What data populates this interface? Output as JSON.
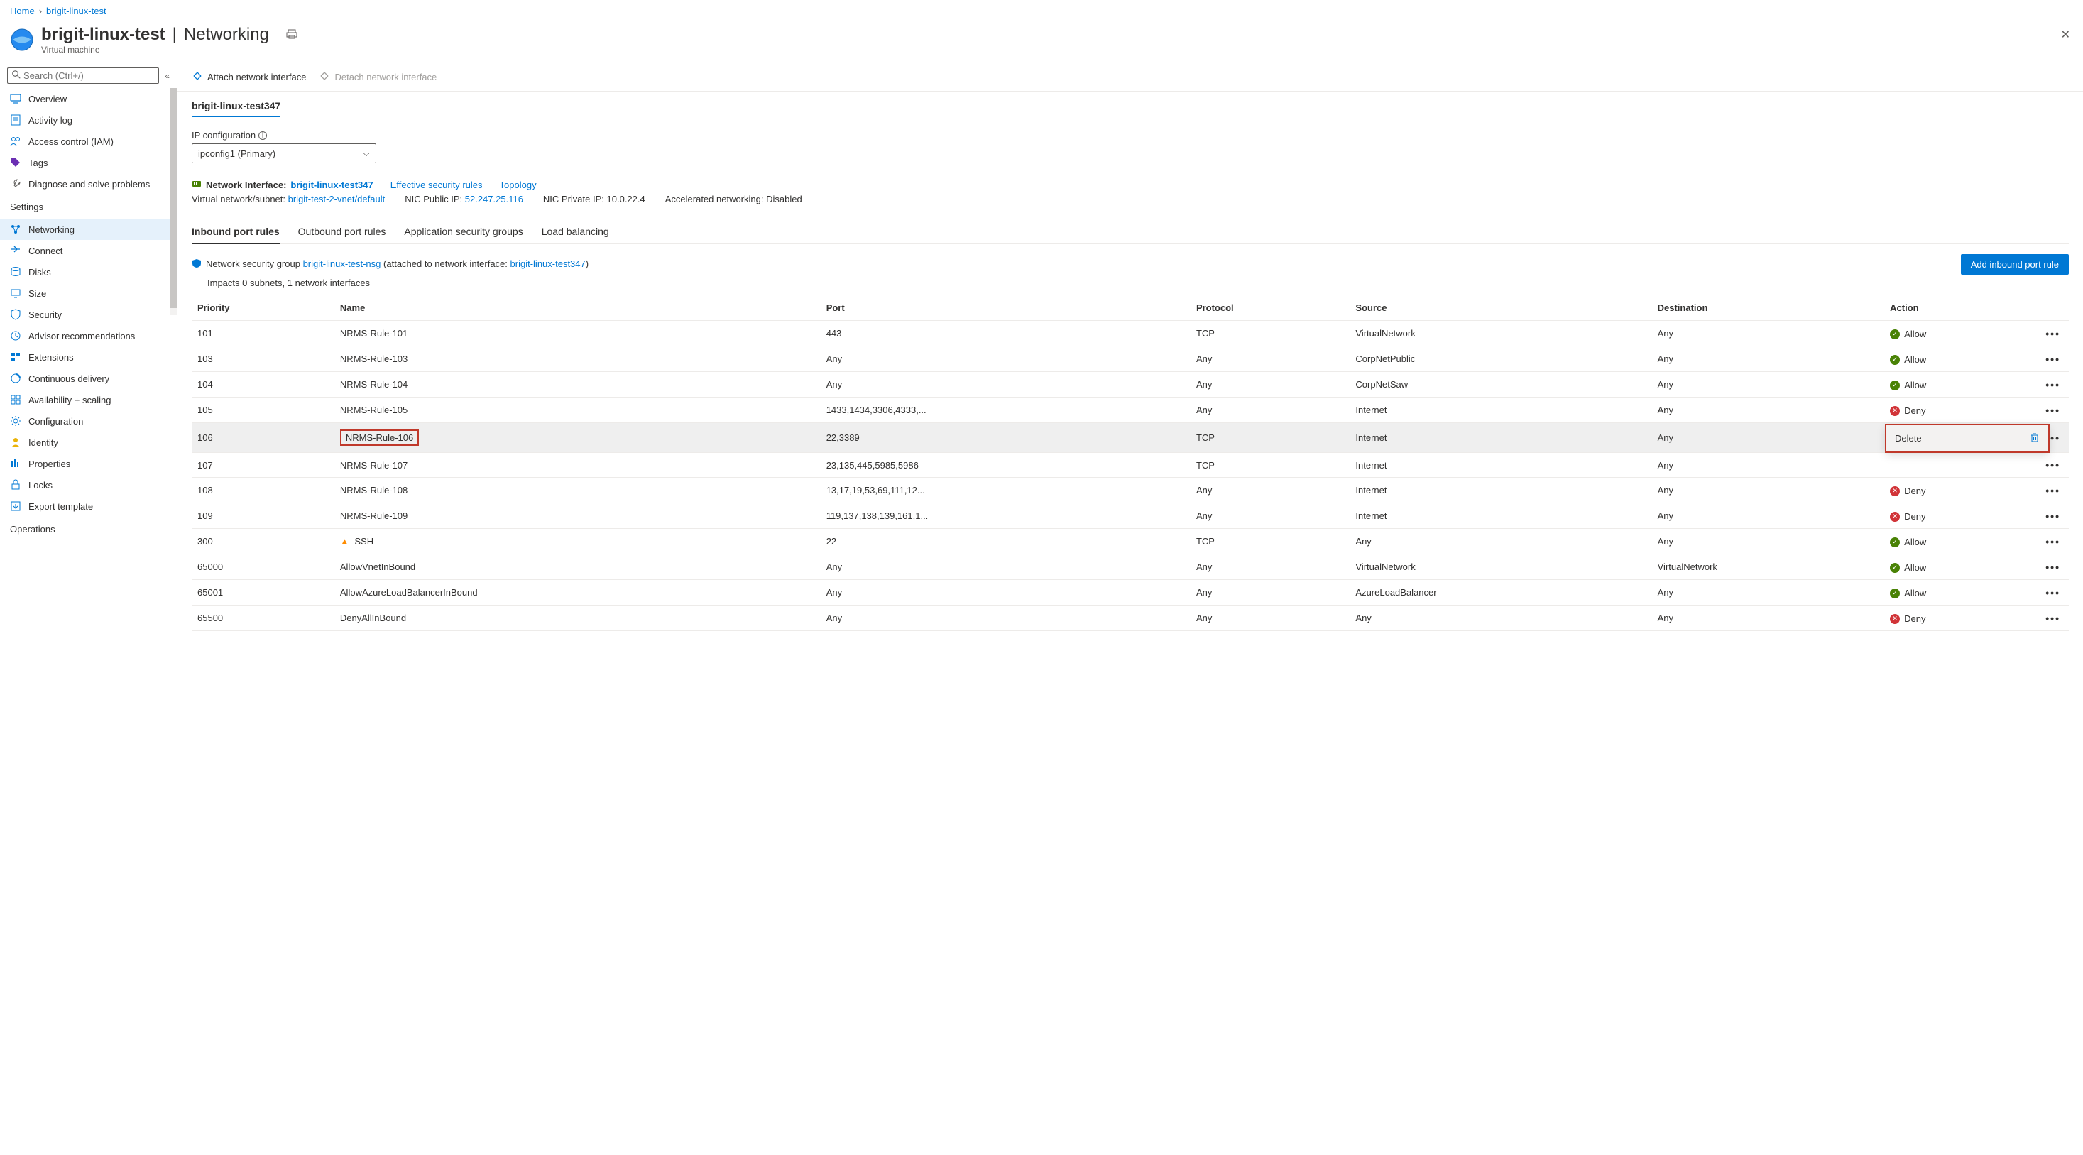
{
  "breadcrumb": {
    "home": "Home",
    "current": "brigit-linux-test"
  },
  "header": {
    "title_main": "brigit-linux-test",
    "title_sub": "Networking",
    "subtitle": "Virtual machine"
  },
  "search": {
    "placeholder": "Search (Ctrl+/)"
  },
  "sidebar": {
    "top_items": [
      {
        "label": "Overview",
        "icon": "monitor"
      },
      {
        "label": "Activity log",
        "icon": "log"
      },
      {
        "label": "Access control (IAM)",
        "icon": "iam"
      },
      {
        "label": "Tags",
        "icon": "tag"
      },
      {
        "label": "Diagnose and solve problems",
        "icon": "wrench"
      }
    ],
    "settings_header": "Settings",
    "settings_items": [
      {
        "label": "Networking",
        "icon": "network",
        "selected": true
      },
      {
        "label": "Connect",
        "icon": "connect"
      },
      {
        "label": "Disks",
        "icon": "disks"
      },
      {
        "label": "Size",
        "icon": "size"
      },
      {
        "label": "Security",
        "icon": "shield"
      },
      {
        "label": "Advisor recommendations",
        "icon": "advisor"
      },
      {
        "label": "Extensions",
        "icon": "extensions"
      },
      {
        "label": "Continuous delivery",
        "icon": "cd"
      },
      {
        "label": "Availability + scaling",
        "icon": "avail"
      },
      {
        "label": "Configuration",
        "icon": "config"
      },
      {
        "label": "Identity",
        "icon": "identity"
      },
      {
        "label": "Properties",
        "icon": "properties"
      },
      {
        "label": "Locks",
        "icon": "lock"
      },
      {
        "label": "Export template",
        "icon": "export"
      }
    ],
    "operations_header": "Operations"
  },
  "toolbar": {
    "attach": "Attach network interface",
    "detach": "Detach network interface"
  },
  "nic": {
    "tab_label": "brigit-linux-test347",
    "ip_config_label": "IP configuration",
    "ip_config_value": "ipconfig1 (Primary)",
    "interface_label": "Network Interface:",
    "interface_link": "brigit-linux-test347",
    "effective_rules": "Effective security rules",
    "topology": "Topology",
    "subnet_label": "Virtual network/subnet:",
    "subnet_link": "brigit-test-2-vnet/default",
    "public_ip_label": "NIC Public IP:",
    "public_ip": "52.247.25.116",
    "private_ip_label": "NIC Private IP:",
    "private_ip": "10.0.22.4",
    "accel_label": "Accelerated networking:",
    "accel_value": "Disabled"
  },
  "rule_tabs": {
    "inbound": "Inbound port rules",
    "outbound": "Outbound port rules",
    "asg": "Application security groups",
    "lb": "Load balancing"
  },
  "nsg": {
    "prefix": "Network security group",
    "link": "brigit-linux-test-nsg",
    "middle": "(attached to network interface:",
    "link2": "brigit-linux-test347",
    "suffix": ")",
    "impacts": "Impacts 0 subnets, 1 network interfaces",
    "add_button": "Add inbound port rule"
  },
  "table": {
    "headers": {
      "priority": "Priority",
      "name": "Name",
      "port": "Port",
      "protocol": "Protocol",
      "source": "Source",
      "destination": "Destination",
      "action": "Action"
    },
    "rows": [
      {
        "priority": "101",
        "name": "NRMS-Rule-101",
        "port": "443",
        "protocol": "TCP",
        "source": "VirtualNetwork",
        "dest": "Any",
        "action": "Allow"
      },
      {
        "priority": "103",
        "name": "NRMS-Rule-103",
        "port": "Any",
        "protocol": "Any",
        "source": "CorpNetPublic",
        "dest": "Any",
        "action": "Allow"
      },
      {
        "priority": "104",
        "name": "NRMS-Rule-104",
        "port": "Any",
        "protocol": "Any",
        "source": "CorpNetSaw",
        "dest": "Any",
        "action": "Allow"
      },
      {
        "priority": "105",
        "name": "NRMS-Rule-105",
        "port": "1433,1434,3306,4333,...",
        "protocol": "Any",
        "source": "Internet",
        "dest": "Any",
        "action": "Deny"
      },
      {
        "priority": "106",
        "name": "NRMS-Rule-106",
        "port": "22,3389",
        "protocol": "TCP",
        "source": "Internet",
        "dest": "Any",
        "action": "",
        "highlight": true
      },
      {
        "priority": "107",
        "name": "NRMS-Rule-107",
        "port": "23,135,445,5985,5986",
        "protocol": "TCP",
        "source": "Internet",
        "dest": "Any",
        "action": ""
      },
      {
        "priority": "108",
        "name": "NRMS-Rule-108",
        "port": "13,17,19,53,69,111,12...",
        "protocol": "Any",
        "source": "Internet",
        "dest": "Any",
        "action": "Deny"
      },
      {
        "priority": "109",
        "name": "NRMS-Rule-109",
        "port": "119,137,138,139,161,1...",
        "protocol": "Any",
        "source": "Internet",
        "dest": "Any",
        "action": "Deny"
      },
      {
        "priority": "300",
        "name": "SSH",
        "warn": true,
        "port": "22",
        "protocol": "TCP",
        "source": "Any",
        "dest": "Any",
        "action": "Allow"
      },
      {
        "priority": "65000",
        "name": "AllowVnetInBound",
        "port": "Any",
        "protocol": "Any",
        "source": "VirtualNetwork",
        "dest": "VirtualNetwork",
        "action": "Allow"
      },
      {
        "priority": "65001",
        "name": "AllowAzureLoadBalancerInBound",
        "port": "Any",
        "protocol": "Any",
        "source": "AzureLoadBalancer",
        "dest": "Any",
        "action": "Allow"
      },
      {
        "priority": "65500",
        "name": "DenyAllInBound",
        "port": "Any",
        "protocol": "Any",
        "source": "Any",
        "dest": "Any",
        "action": "Deny"
      }
    ]
  },
  "context_menu": {
    "delete": "Delete"
  }
}
